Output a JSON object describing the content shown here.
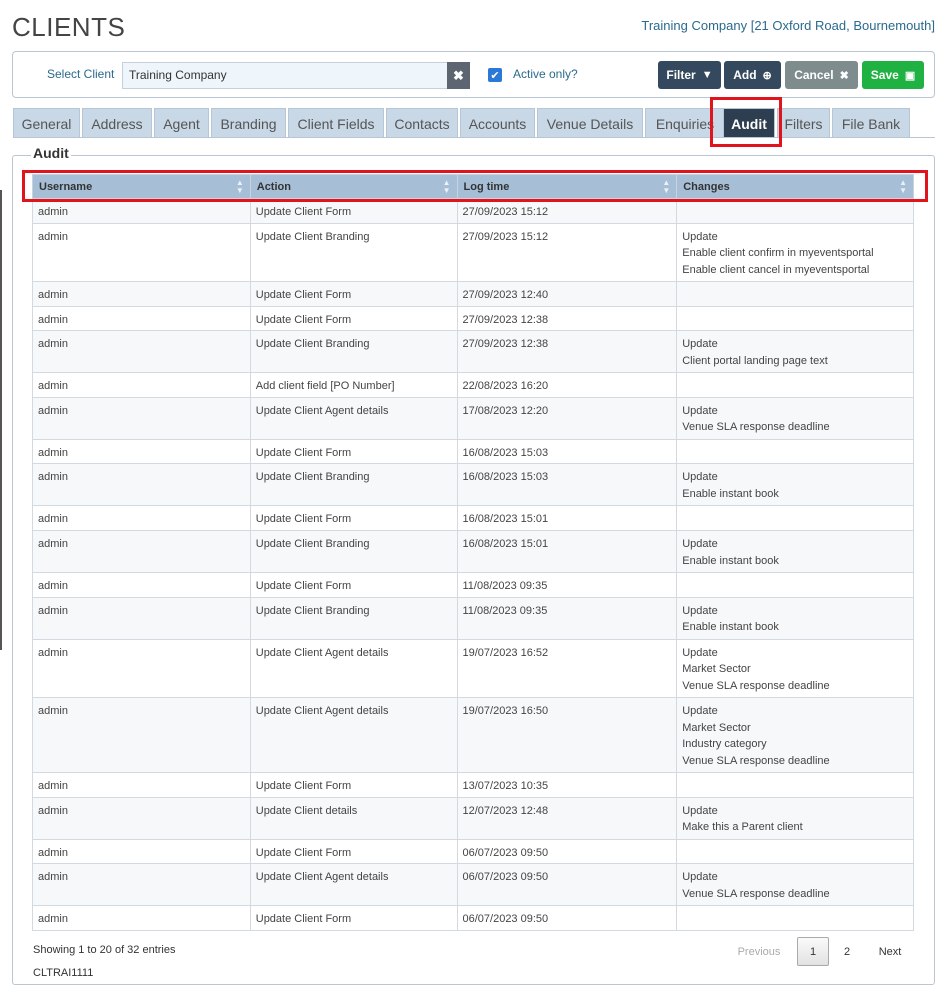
{
  "header": {
    "title": "CLIENTS",
    "company": "Training Company [21 Oxford Road, Bournemouth]"
  },
  "toolbar": {
    "select_label": "Select Client",
    "select_value": "Training Company",
    "clear_icon": "close-icon",
    "active_label": "Active only?",
    "active_checked": true,
    "buttons": {
      "filter": "Filter",
      "add": "Add",
      "cancel": "Cancel",
      "save": "Save"
    },
    "colors": {
      "filter": "#34495e",
      "add": "#34495e",
      "cancel": "#7f8c8d",
      "save": "#1fb141"
    }
  },
  "tabs": [
    "General",
    "Address",
    "Agent",
    "Branding",
    "Client Fields",
    "Contacts",
    "Accounts",
    "Venue Details",
    "Enquiries",
    "Audit",
    "Filters",
    "File Bank"
  ],
  "active_tab": "Audit",
  "audit": {
    "legend": "Audit",
    "columns": [
      "Username",
      "Action",
      "Log time",
      "Changes"
    ],
    "rows": [
      {
        "user": "admin",
        "action": "Update Client Form",
        "time": "27/09/2023 15:12",
        "changes": []
      },
      {
        "user": "admin",
        "action": "Update Client Branding",
        "time": "27/09/2023 15:12",
        "changes": [
          "Update",
          "Enable client confirm in myeventsportal",
          "Enable client cancel in myeventsportal"
        ]
      },
      {
        "user": "admin",
        "action": "Update Client Form",
        "time": "27/09/2023 12:40",
        "changes": []
      },
      {
        "user": "admin",
        "action": "Update Client Form",
        "time": "27/09/2023 12:38",
        "changes": []
      },
      {
        "user": "admin",
        "action": "Update Client Branding",
        "time": "27/09/2023 12:38",
        "changes": [
          "Update",
          "Client portal landing page text"
        ]
      },
      {
        "user": "admin",
        "action": "Add client field [PO Number]",
        "time": "22/08/2023 16:20",
        "changes": []
      },
      {
        "user": "admin",
        "action": "Update Client Agent details",
        "time": "17/08/2023 12:20",
        "changes": [
          "Update",
          "Venue SLA response deadline"
        ]
      },
      {
        "user": "admin",
        "action": "Update Client Form",
        "time": "16/08/2023 15:03",
        "changes": []
      },
      {
        "user": "admin",
        "action": "Update Client Branding",
        "time": "16/08/2023 15:03",
        "changes": [
          "Update",
          "Enable instant book"
        ]
      },
      {
        "user": "admin",
        "action": "Update Client Form",
        "time": "16/08/2023 15:01",
        "changes": []
      },
      {
        "user": "admin",
        "action": "Update Client Branding",
        "time": "16/08/2023 15:01",
        "changes": [
          "Update",
          "Enable instant book"
        ]
      },
      {
        "user": "admin",
        "action": "Update Client Form",
        "time": "11/08/2023 09:35",
        "changes": []
      },
      {
        "user": "admin",
        "action": "Update Client Branding",
        "time": "11/08/2023 09:35",
        "changes": [
          "Update",
          "Enable instant book"
        ]
      },
      {
        "user": "admin",
        "action": "Update Client Agent details",
        "time": "19/07/2023 16:52",
        "changes": [
          "Update",
          "Market Sector",
          "Venue SLA response deadline"
        ]
      },
      {
        "user": "admin",
        "action": "Update Client Agent details",
        "time": "19/07/2023 16:50",
        "changes": [
          "Update",
          "Market Sector",
          "Industry category",
          "Venue SLA response deadline"
        ]
      },
      {
        "user": "admin",
        "action": "Update Client Form",
        "time": "13/07/2023 10:35",
        "changes": []
      },
      {
        "user": "admin",
        "action": "Update Client details",
        "time": "12/07/2023 12:48",
        "changes": [
          "Update",
          "Make this a Parent client"
        ]
      },
      {
        "user": "admin",
        "action": "Update Client Form",
        "time": "06/07/2023 09:50",
        "changes": []
      },
      {
        "user": "admin",
        "action": "Update Client Agent details",
        "time": "06/07/2023 09:50",
        "changes": [
          "Update",
          "Venue SLA response deadline"
        ]
      },
      {
        "user": "admin",
        "action": "Update Client Form",
        "time": "06/07/2023 09:50",
        "changes": []
      }
    ],
    "info": "Showing 1 to 20 of 32 entries",
    "client_code": "CLTRAI1111"
  },
  "pagination": {
    "previous": "Previous",
    "pages": [
      "1",
      "2"
    ],
    "current": "1",
    "next": "Next"
  }
}
